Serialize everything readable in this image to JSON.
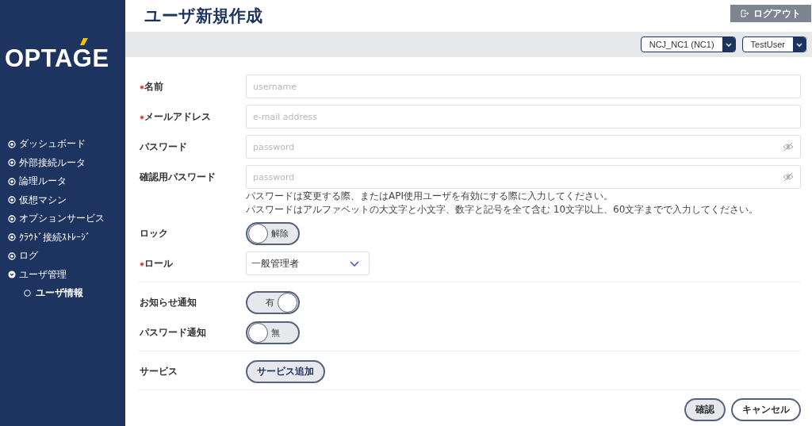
{
  "sidebar": {
    "logo": "OPTAGE",
    "items": [
      {
        "label": "ダッシュボード",
        "expanded": false
      },
      {
        "label": "外部接続ルータ",
        "expanded": false
      },
      {
        "label": "論理ルータ",
        "expanded": false
      },
      {
        "label": "仮想マシン",
        "expanded": false
      },
      {
        "label": "オプションサービス",
        "expanded": false
      },
      {
        "label": "ｸﾗｳﾄﾞ接続ｽﾄﾚｰｼﾞ",
        "expanded": false
      },
      {
        "label": "ログ",
        "expanded": false
      },
      {
        "label": "ユーザ管理",
        "expanded": true,
        "children": [
          {
            "label": "ユーザ情報",
            "selected": true
          }
        ]
      }
    ]
  },
  "header": {
    "title": "ユーザ新規作成",
    "logout": "ログアウト",
    "selectors": [
      "NCJ_NC1 (NC1)",
      "TestUser"
    ]
  },
  "form": {
    "fields": [
      {
        "label": "名前",
        "required": true,
        "kind": "text",
        "placeholder": "username"
      },
      {
        "label": "メールアドレス",
        "required": true,
        "kind": "text",
        "placeholder": "e-mail address"
      },
      {
        "label": "パスワード",
        "required": false,
        "kind": "password",
        "placeholder": "password"
      },
      {
        "label": "確認用パスワード",
        "required": false,
        "kind": "password",
        "placeholder": "password"
      }
    ],
    "hints": [
      "パスワードは変更する際、またはAPI使用ユーザを有効にする際に入力してください。",
      "パスワードはアルファベットの大文字と小文字、数字と記号を全て含む 10文字以上、60文字までで入力してください。"
    ],
    "lock": {
      "label": "ロック",
      "on": false,
      "text": "解除"
    },
    "role": {
      "label": "ロール",
      "required": true,
      "value": "一般管理者"
    },
    "notifications": [
      {
        "label": "お知らせ通知",
        "on": true,
        "text": "有"
      },
      {
        "label": "パスワード通知",
        "on": false,
        "text": "無"
      }
    ],
    "service": {
      "label": "サービス",
      "button": "サービス追加"
    },
    "buttons": [
      "確認",
      "キャンセル"
    ]
  }
}
